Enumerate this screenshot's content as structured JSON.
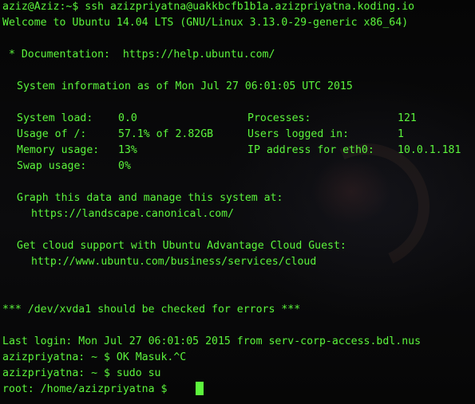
{
  "terminal": {
    "text_color": "#5cf53c",
    "background_color": "#0a0a0a",
    "ssh_command": "aziz@Aziz:~$ ssh azizpriyatna@uakkbcfb1b1a.azizpriyatna.koding.io",
    "welcome": "Welcome to Ubuntu 14.04 LTS (GNU/Linux 3.13.0-29-generic x86_64)",
    "documentation": " * Documentation:  https://help.ubuntu.com/",
    "system_info": "System information as of Mon Jul 27 06:01:05 UTC 2015",
    "stats": {
      "system_load_label": "System load:",
      "system_load_value": "0.0",
      "processes_label": "Processes:",
      "processes_value": "121",
      "disk_usage_label": "Usage of /:",
      "disk_usage_value": "57.1% of 2.82GB",
      "users_label": "Users logged in:",
      "users_value": "1",
      "memory_label": "Memory usage:",
      "memory_value": "13%",
      "ip_label": "IP address for eth0:",
      "ip_value": "10.0.1.181",
      "swap_label": "Swap usage:",
      "swap_value": "0%"
    },
    "graph_text": "Graph this data and manage this system at:",
    "landscape_url": "https://landscape.canonical.com/",
    "cloud_text": "Get cloud support with Ubuntu Advantage Cloud Guest:",
    "cloud_url": "http://www.ubuntu.com/business/services/cloud",
    "disk_warning": "*** /dev/xvda1 should be checked for errors ***",
    "last_login": "Last login: Mon Jul 27 06:01:05 2015 from serv-corp-access.bdl.nus",
    "prompt1": "azizpriyatna: ~ $ OK Masuk.^C",
    "prompt2": "azizpriyatna: ~ $ sudo su",
    "root_prompt": "root: /home/azizpriyatna $ "
  }
}
